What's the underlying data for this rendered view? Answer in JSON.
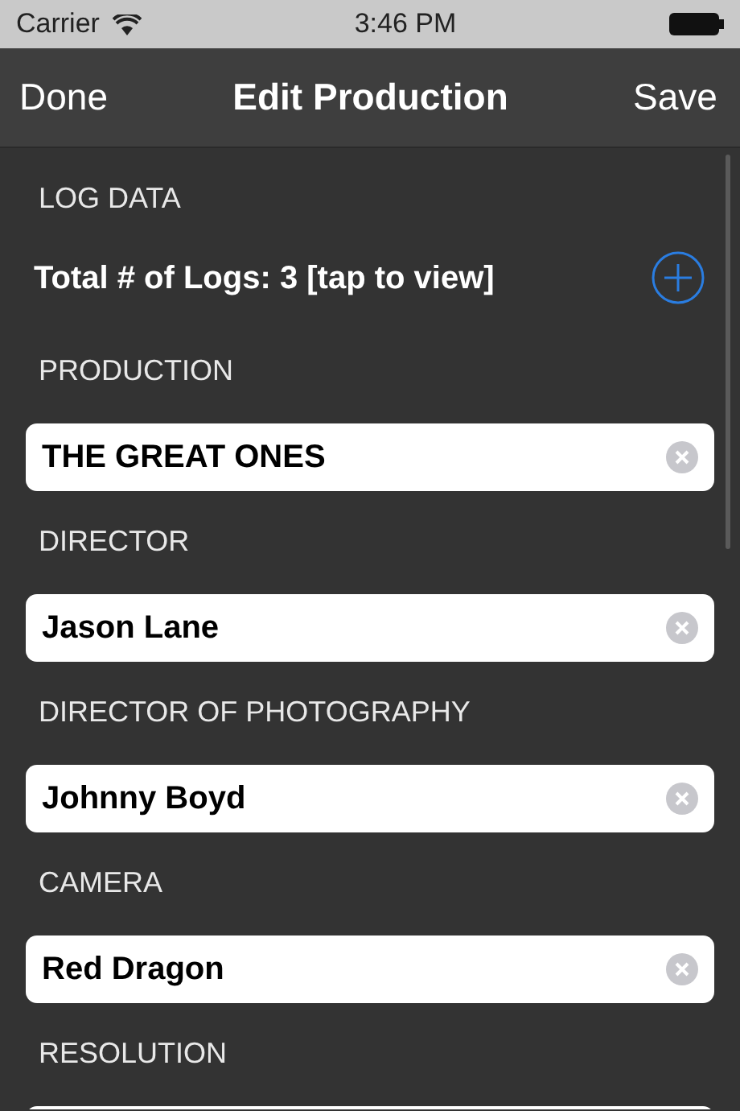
{
  "status_bar": {
    "carrier": "Carrier",
    "time": "3:46 PM"
  },
  "nav_bar": {
    "left_button": "Done",
    "title": "Edit Production",
    "right_button": "Save"
  },
  "log_section": {
    "header": "LOG DATA",
    "summary": "Total # of Logs: 3 [tap to view]"
  },
  "fields": [
    {
      "label": "PRODUCTION",
      "value": "THE GREAT ONES"
    },
    {
      "label": "DIRECTOR",
      "value": "Jason Lane"
    },
    {
      "label": "DIRECTOR OF PHOTOGRAPHY",
      "value": "Johnny Boyd"
    },
    {
      "label": "CAMERA",
      "value": "Red Dragon"
    },
    {
      "label": "RESOLUTION"
    }
  ]
}
